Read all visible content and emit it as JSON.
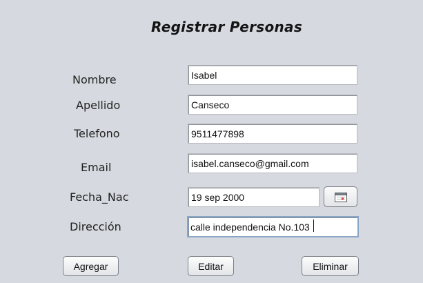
{
  "form": {
    "title": "Registrar Personas",
    "fields": [
      {
        "label": "Nombre",
        "value": "Isabel"
      },
      {
        "label": "Apellido",
        "value": "Canseco"
      },
      {
        "label": "Telefono",
        "value": "9511477898"
      },
      {
        "label": "Email",
        "value": "isabel.canseco@gmail.com"
      },
      {
        "label": "Fecha_Nac",
        "value": "19 sep 2000"
      },
      {
        "label": "Dirección",
        "value": "calle independencia No.103"
      }
    ],
    "date_picker_icon": "calendar-icon",
    "buttons": {
      "add": "Agregar",
      "edit": "Editar",
      "delete": "Eliminar"
    }
  }
}
